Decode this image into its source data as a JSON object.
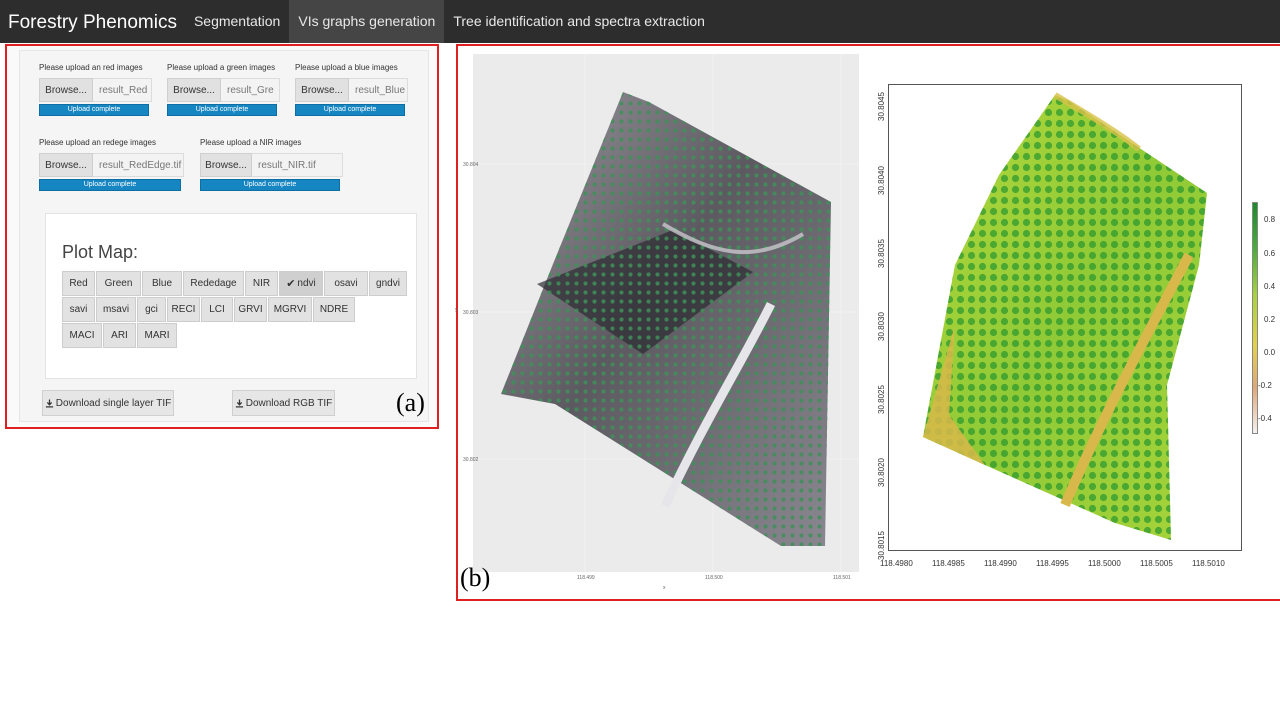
{
  "navbar": {
    "brand": "Forestry Phenomics",
    "tabs": [
      {
        "label": "Segmentation",
        "active": false
      },
      {
        "label": "VIs graphs generation",
        "active": true
      },
      {
        "label": "Tree identification and spectra extraction",
        "active": false
      }
    ]
  },
  "panel_a": {
    "figure_label": "(a)",
    "uploads": [
      {
        "label": "Please upload an red images",
        "button": "Browse...",
        "file": "result_Red",
        "status": "Upload complete"
      },
      {
        "label": "Please upload a green images",
        "button": "Browse...",
        "file": "result_Gre",
        "status": "Upload complete"
      },
      {
        "label": "Please upload a blue images",
        "button": "Browse...",
        "file": "result_Blue",
        "status": "Upload complete"
      },
      {
        "label": "Please upload an redege images",
        "button": "Browse...",
        "file": "result_RedEdge.tif",
        "status": "Upload complete"
      },
      {
        "label": "Please upload a NIR images",
        "button": "Browse...",
        "file": "result_NIR.tif",
        "status": "Upload complete"
      }
    ],
    "plot_map": {
      "title": "Plot Map:",
      "selected": "ndvi",
      "rows": [
        [
          "Red",
          "Green",
          "Blue",
          "Rededage",
          "NIR",
          "ndvi",
          "osavi",
          "gndvi"
        ],
        [
          "savi",
          "msavi",
          "gci",
          "RECI",
          "LCI",
          "GRVI",
          "MGRVI",
          "NDRE"
        ],
        [
          "MACI",
          "ARI",
          "MARI"
        ]
      ]
    },
    "downloads": {
      "single": "Download single layer TIF",
      "rgb": "Download RGB TIF"
    }
  },
  "panel_b": {
    "figure_label": "(b)",
    "left_map": {
      "x_ticks": [
        "118.499",
        "118.500",
        "118.501"
      ],
      "y_ticks": [
        "30.804",
        "30.803",
        "30.802"
      ],
      "x_label": "x",
      "y_label": "y"
    },
    "right_map": {
      "x_ticks": [
        "118.4980",
        "118.4985",
        "118.4990",
        "118.4995",
        "118.5000",
        "118.5005",
        "118.5010"
      ],
      "y_ticks": [
        "30.8045",
        "30.8040",
        "30.8035",
        "30.8030",
        "30.8025",
        "30.8020",
        "30.8015"
      ],
      "colorbar_ticks": [
        "0.8",
        "0.6",
        "0.4",
        "0.2",
        "0.0",
        "-0.2",
        "-0.4"
      ],
      "colors": {
        "high": "#1a8a2a",
        "mid": "#a8d23e",
        "low": "#e1a777",
        "min": "#f4f0ef"
      }
    }
  }
}
